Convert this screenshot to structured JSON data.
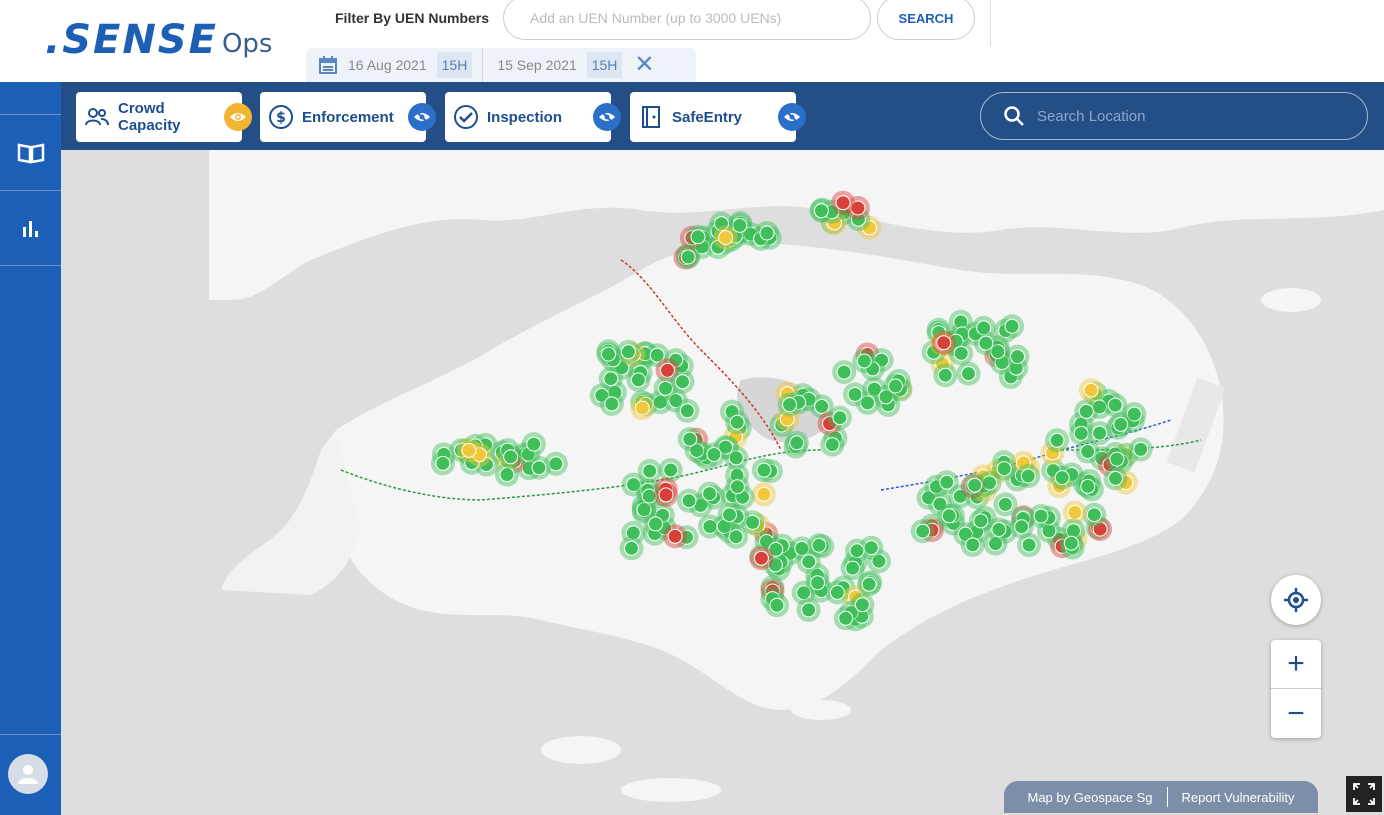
{
  "app": {
    "logo_main": ".SENSE",
    "logo_sub": "Ops"
  },
  "filter": {
    "label": "Filter By UEN Numbers",
    "placeholder": "Add an UEN Number (up to 3000 UENs)",
    "search_label": "SEARCH"
  },
  "dates": {
    "start_date": "16 Aug 2021",
    "start_hour": "15H",
    "end_date": "15 Sep 2021",
    "end_hour": "15H",
    "clear_icon": "close-icon"
  },
  "sidebar": {
    "items": [
      {
        "icon": "book-icon"
      },
      {
        "icon": "bar-chart-icon"
      }
    ],
    "avatar_icon": "user-avatar-icon"
  },
  "layers": [
    {
      "label_line1": "Crowd",
      "label_line2": "Capacity",
      "icon": "people-icon",
      "visible": true
    },
    {
      "label": "Enforcement",
      "icon": "dollar-circle-icon",
      "visible": false
    },
    {
      "label": "Inspection",
      "icon": "check-circle-icon",
      "visible": false
    },
    {
      "label": "SafeEntry",
      "icon": "door-icon",
      "visible": false
    }
  ],
  "location_search": {
    "placeholder": "Search Location"
  },
  "map": {
    "controls": {
      "locate_icon": "locate-icon",
      "zoom_in": "+",
      "zoom_out": "−"
    },
    "attribution_left": "Map by Geospace Sg",
    "attribution_right": "Report Vulnerability",
    "fullscreen_icon": "fullscreen-icon",
    "colors": {
      "green": "#3fbf5a",
      "yellow": "#f2c83a",
      "red": "#d9403a",
      "sea": "#dedede",
      "land": "#f5f5f5"
    }
  }
}
